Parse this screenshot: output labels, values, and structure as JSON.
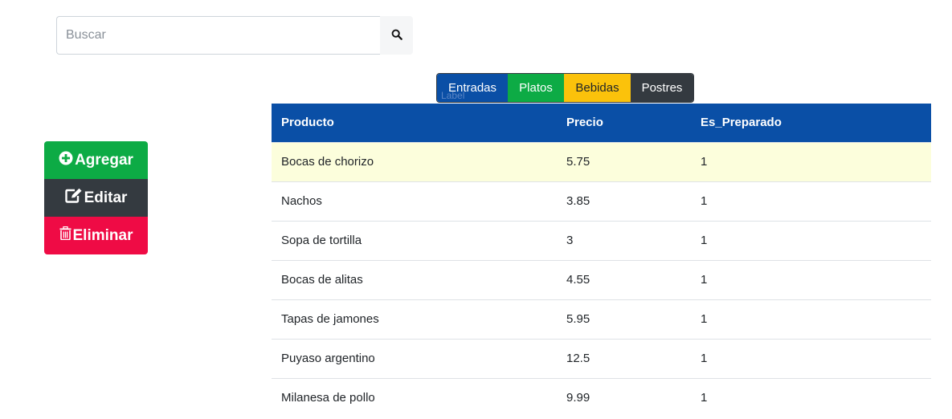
{
  "search": {
    "placeholder": "Buscar",
    "value": "",
    "icon": "search-icon"
  },
  "categories": {
    "tabs": [
      {
        "label": "Entradas",
        "color": "#0a4fa6"
      },
      {
        "label": "Platos",
        "color": "#0dab45"
      },
      {
        "label": "Bebidas",
        "color": "#fbc20b"
      },
      {
        "label": "Postres",
        "color": "#343a40"
      }
    ],
    "caption": "Label"
  },
  "actions": {
    "add_label": "Agregar",
    "edit_label": "Editar",
    "delete_label": "Eliminar"
  },
  "table": {
    "headers": [
      "Producto",
      "Precio",
      "Es_Preparado"
    ],
    "rows": [
      [
        "Bocas de chorizo",
        "5.75",
        "1"
      ],
      [
        "Nachos",
        "3.85",
        "1"
      ],
      [
        "Sopa de tortilla",
        "3",
        "1"
      ],
      [
        "Bocas de alitas",
        "4.55",
        "1"
      ],
      [
        "Tapas de jamones",
        "5.95",
        "1"
      ],
      [
        "Puyaso argentino",
        "12.5",
        "1"
      ],
      [
        "Milanesa de pollo",
        "9.99",
        "1"
      ]
    ],
    "selected_row": 0,
    "header_color": "#0a4fa6",
    "selected_color": "#fcfedc"
  }
}
